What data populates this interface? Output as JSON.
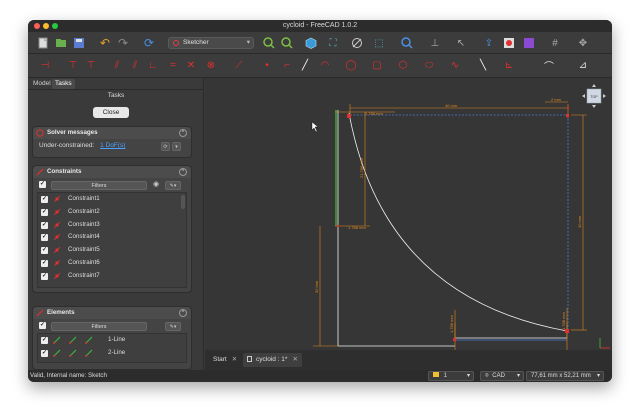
{
  "window": {
    "title": "cycloid - FreeCAD 1.0.2",
    "traffic_lights": [
      "#ff5f57",
      "#febc2e",
      "#28c840"
    ]
  },
  "toolbar": {
    "workbench": "Sketcher"
  },
  "panel": {
    "tabs": [
      "Model",
      "Tasks"
    ],
    "tasks_header": "Tasks",
    "close_label": "Close",
    "solver": {
      "title": "Solver messages",
      "status_label": "Under-constrained:",
      "dof_link": "1 DoF(s)"
    },
    "constraints": {
      "title": "Constraints",
      "filter_label": "Filters",
      "items": [
        "Constraint1",
        "Constraint2",
        "Constraint3",
        "Constraint4",
        "Constraint5",
        "Constraint6",
        "Constraint7"
      ]
    },
    "elements": {
      "title": "Elements",
      "filter_label": "Filters",
      "items": [
        "1-Line",
        "2-Line"
      ]
    }
  },
  "sketch": {
    "dimensions": {
      "top_width": "40 mm",
      "top_small": "1.788 mm",
      "left_upper": "21.788 mm",
      "left_small": "1.788 mm",
      "left_lower": "32 mm",
      "top_right": "2 mm",
      "right_vertical": "40 mm",
      "bottom_small_left": "1.788 mm",
      "bottom_small_right": "1.788 mm",
      "bottom_left": "32 mm",
      "bottom_right": "21.788 mm"
    },
    "colors": {
      "dimension": "#e08a1e",
      "geometry": "#f0f0f0",
      "construction": "#4a7ed8",
      "constraint": "#e03030",
      "selected_line": "#3cc03c"
    }
  },
  "doc_tabs": [
    {
      "label": "Start",
      "active": false
    },
    {
      "label": "cycloid : 1*",
      "active": true
    }
  ],
  "statusbar": {
    "message": "Valid, Internal name: Sketch",
    "page_value": "1",
    "nav_style": "CAD",
    "dimensions": "77,61 mm x 52,21 mm"
  }
}
